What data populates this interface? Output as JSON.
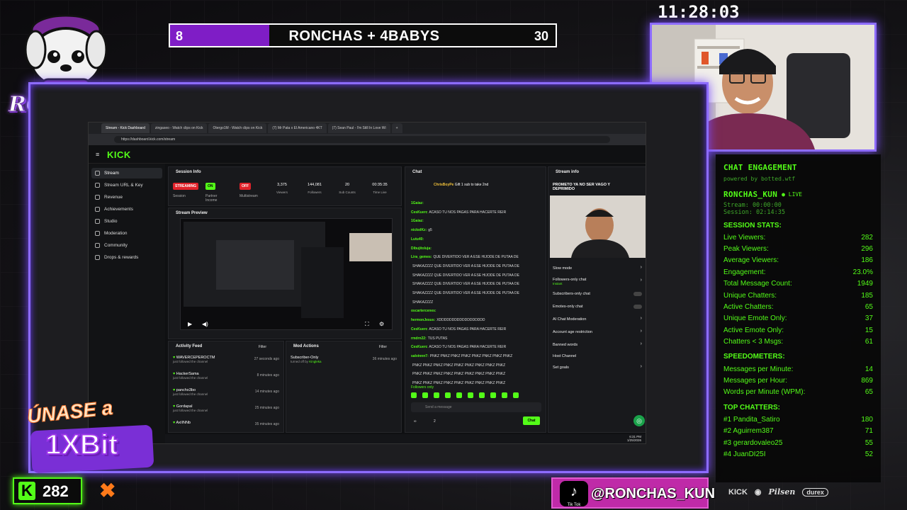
{
  "logo": {
    "text": "RONCHAS"
  },
  "clock": "11:28:03",
  "scorebar": {
    "left_score": "8",
    "title": "RONCHAS + 4BABYS",
    "right_score": "30"
  },
  "browser": {
    "tabs": [
      "Stream - Kick Dashboard",
      "zingaseo - Watch clips on Kick",
      "Otergo1M - Watch clips on Kick",
      "(7) Mr Pata x El Americano 4KT",
      "(7) Sean Paul - I'm Still In Love Wi"
    ],
    "url": "https://dashboard.kick.com/stream",
    "logo": "KICK",
    "sidebar": [
      "Stream",
      "Stream URL & Key",
      "Revenue",
      "Achievements",
      "Studio",
      "Moderation",
      "Community",
      "Drops & rewards"
    ],
    "session_info": {
      "title": "Session Info",
      "badges": [
        "STREAMING",
        "ON",
        "OFF"
      ],
      "badge_labels": [
        "Session",
        "Partner Income",
        "Multistream"
      ],
      "stats": [
        {
          "value": "3,375",
          "label": "Viewers"
        },
        {
          "value": "144,081",
          "label": "Followers"
        },
        {
          "value": "20",
          "label": "Sub Counts"
        },
        {
          "value": "00:35:35",
          "label": "Time Live"
        }
      ]
    },
    "stream_preview": {
      "title": "Stream Preview"
    },
    "activity_feed": {
      "title": "Activity Feed",
      "filter": "Filter",
      "items": [
        {
          "name": "WAVERCEPEROCTM",
          "sub": "just followed the channel",
          "time": "27 seconds ago"
        },
        {
          "name": "HackerSama",
          "sub": "just followed the channel",
          "time": "8 minutes ago"
        },
        {
          "name": "pancho3bo",
          "sub": "just followed the channel",
          "time": "14 minutes ago"
        },
        {
          "name": "Gordapal",
          "sub": "just followed the channel",
          "time": "25 minutes ago"
        },
        {
          "name": "AxIINNb",
          "sub": "just followed the channel",
          "time": "35 minutes ago"
        }
      ]
    },
    "mod_actions": {
      "title": "Mod Actions",
      "filter": "Filter",
      "item": "Subscriber-Only",
      "item_sub": "turned off by",
      "item_user": "Kingleka",
      "item_time": "36 minutes ago"
    },
    "chat": {
      "title": "Chat",
      "pinned_user": "ChrisBoyPe",
      "pinned_text": "Gift 1 sub to take 2nd",
      "lines": [
        {
          "user": "1Gaiaz:",
          "text": ""
        },
        {
          "user": "CesKuerc",
          "text": "ACASO TU NOS PAGAS PARA HACERTE REIR"
        },
        {
          "user": "1Gaiaz:",
          "text": ""
        },
        {
          "user": "nickoIKz:",
          "text": "g5"
        },
        {
          "user": "Lutu40:",
          "text": ""
        },
        {
          "user": "Dibujitoluja:",
          "text": ""
        },
        {
          "user": "Lira_gemes:",
          "text": "QUE DIVERTIDO VER A ESE HIJODE DE PUTAA DE"
        },
        {
          "user": "",
          "text": "SHAKAZZZZ QUE DIVERTIDO VER A ESE HIJODE DE PUTAA DE"
        },
        {
          "user": "",
          "text": "SHAKAZZZZ QUE DIVERTIDO VER A ESE HIJODE DE PUTAA DE"
        },
        {
          "user": "",
          "text": "SHAKAZZZZ QUE DIVERTIDO VER A ESE HIJODE DE PUTAA DE"
        },
        {
          "user": "",
          "text": "SHAKAZZZZ QUE DIVERTIDO VER A ESE HIJODE DE PUTAA DE"
        },
        {
          "user": "",
          "text": "SHAKAZZZZ"
        },
        {
          "user": "oscartercenes:",
          "text": ""
        },
        {
          "user": "hermonJesus:",
          "text": "XDDDDDDDDDDDDDDDDDD"
        },
        {
          "user": "CesKuerc",
          "text": "ACASO TU NOS PAGAS PARA HACERTE REIR"
        },
        {
          "user": "rmdrn22:",
          "text": "TUS PUTAS"
        },
        {
          "user": "CesKuerc",
          "text": "ACASO TU NOS PAGAS PARA HACERTE REIR"
        },
        {
          "user": "salvinnn7:",
          "text": "PNKZ PNKZ PNKZ PNKZ PNKZ PNKZ PNKZ PNKZ"
        },
        {
          "user": "",
          "text": "PNKZ PNKZ PNKZ PNKZ PNKZ PNKZ PNKZ PNKZ PNKZ"
        },
        {
          "user": "",
          "text": "PNKZ PNKZ PNKZ PNKZ PNKZ PNKZ PNKZ PNKZ PNKZ"
        },
        {
          "user": "",
          "text": "PNKZ PNKZ PNKZ PNKZ PNKZ PNKZ PNKZ PNKZ PNKZ"
        }
      ],
      "followers_only": "Followers only",
      "placeholder": "Send a message",
      "send_label": "Chat",
      "count_a": "∞",
      "count_b": "2"
    },
    "stream_info": {
      "title": "Stream info",
      "stream_title": "PROMETO YA NO SER VAGO Y DEPRIMIDO",
      "items": [
        "Slow mode",
        "Followers-only chat",
        "Subscribers-only chat",
        "Emotes-only chat",
        "AI Chat Moderation",
        "Account age restriction",
        "Banned words",
        "Host Channel",
        "Set goals"
      ],
      "followers_only_sub": "Instant"
    },
    "taskbar": {
      "time": "6:31 PM",
      "date": "1/25/2026"
    }
  },
  "engagement": {
    "title": "CHAT ENGAGEMENT",
    "powered": "powered by botted.wtf",
    "channel": "RONCHAS_KUN",
    "live": "● LIVE",
    "stream_time": "Stream: 00:00:00",
    "session_time": "Session: 02:14:35",
    "session_header": "SESSION STATS:",
    "session_stats": [
      {
        "label": "Live Viewers:",
        "value": "282"
      },
      {
        "label": "Peak Viewers:",
        "value": "296"
      },
      {
        "label": "Average Viewers:",
        "value": "186"
      },
      {
        "label": "Engagement:",
        "value": "23.0%"
      },
      {
        "label": "Total Message Count:",
        "value": "1949"
      },
      {
        "label": "Unique Chatters:",
        "value": "185"
      },
      {
        "label": "Active Chatters:",
        "value": "65"
      },
      {
        "label": "Unique Emote Only:",
        "value": "37"
      },
      {
        "label": "Active Emote Only:",
        "value": "15"
      },
      {
        "label": "Chatters < 3 Msgs:",
        "value": "61"
      }
    ],
    "speed_header": "SPEEDOMETERS:",
    "speed": [
      {
        "label": "Messages per Minute:",
        "value": "14"
      },
      {
        "label": "Messages per Hour:",
        "value": "869"
      },
      {
        "label": "Words per Minute (WPM):",
        "value": "65"
      }
    ],
    "top_header": "TOP CHATTERS:",
    "top": [
      {
        "label": "#1 Pandita_Satiro",
        "value": "180"
      },
      {
        "label": "#2 Aguirrem387",
        "value": "71"
      },
      {
        "label": "#3 gerardovaleo25",
        "value": "55"
      },
      {
        "label": "#4 JuanDI25I",
        "value": "52"
      }
    ]
  },
  "promo": {
    "line1": "ÚNASE a",
    "line2": "1XBit"
  },
  "kick_viewers": {
    "icon": "K",
    "count": "282"
  },
  "tiktok": {
    "label": "Tik Tok",
    "handle": "@RONCHAS_KUN"
  },
  "sponsors": [
    "KICK",
    "Pilsen",
    "durex"
  ],
  "colors": {
    "kick_green": "#53fc18",
    "frame_purple": "#8d6cff",
    "score_purple": "#7f1dc6",
    "tiktok_pink": "#bf2aa8"
  }
}
